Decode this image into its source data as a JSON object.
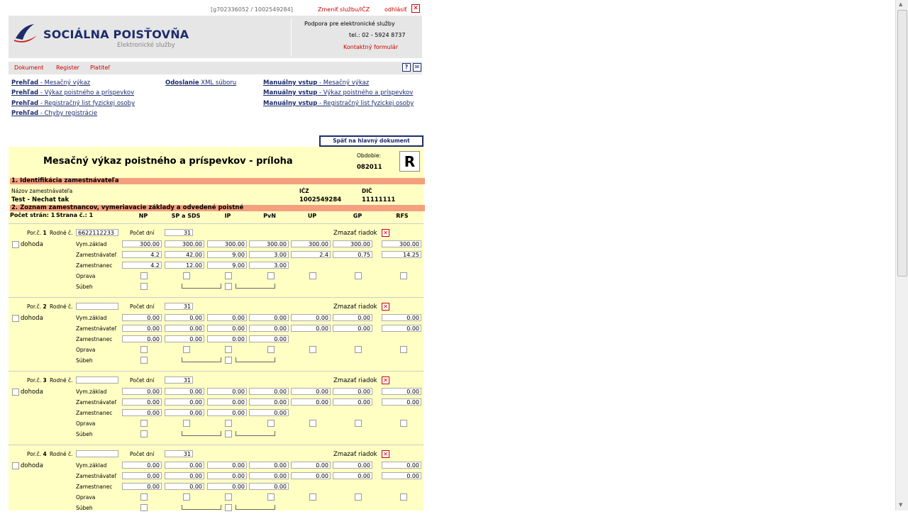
{
  "topbar": {
    "session": "[g702336052 / 1002549284]",
    "change_link": "Zmeniť službu/IČZ",
    "logout_link": "odhlásiť"
  },
  "header": {
    "logo_title": "SOCIÁLNA POISŤOVŇA",
    "logo_subtitle": "Elektronické služby",
    "support": "Podpora pre elektronické služby",
    "phone": "tel.: 02 - 5924 8737",
    "contact": "Kontaktný formulár"
  },
  "nav": {
    "items": [
      "Dokument",
      "Register",
      "Platiteľ"
    ]
  },
  "links": {
    "col1": [
      {
        "bold": "Prehľad",
        "rest": " - Mesačný výkaz"
      },
      {
        "bold": "Prehľad",
        "rest": " - Výkaz poistného a príspevkov"
      },
      {
        "bold": "Prehľad",
        "rest": " - Registračný list fyzickej osoby"
      },
      {
        "bold": "Prehľad",
        "rest": " - Chyby registrácie"
      }
    ],
    "col2": [
      {
        "bold": "Odoslanie",
        "rest": " XML súboru"
      }
    ],
    "col3": [
      {
        "bold": "Manuálny vstup",
        "rest": " - Mesačný výkaz"
      },
      {
        "bold": "Manuálny vstup",
        "rest": " - Výkaz poistného a príspevkov"
      },
      {
        "bold": "Manuálny vstup",
        "rest": " - Registračný list fyzickej osoby"
      }
    ]
  },
  "back_button": "Späť na hlavný dokument",
  "form": {
    "title": "Mesačný výkaz poistného a príspevkov - príloha",
    "period_label": "Obdobie:",
    "period_value": "082011",
    "letter": "R",
    "section1": "1. Identifikácia zamestnávateľa",
    "employer_name_label": "Názov zamestnávateľa",
    "employer_name": "Test - Nechat tak",
    "icz_label": "IČZ",
    "icz": "1002549284",
    "dic_label": "DIČ",
    "dic": "11111111",
    "section2": "2. Zoznam zamestnancov, vymeriavacie základy a odvedené poistné",
    "pages_label": "Počet strán:",
    "pages": "1",
    "page_label": "Strana č.:",
    "page": "1",
    "columns": [
      "NP",
      "SP a SDS",
      "IP",
      "PvN",
      "UP",
      "GP",
      "RFS"
    ],
    "labels": {
      "porc": "Por.č.",
      "rodne": "Rodné č.",
      "days": "Počet dní",
      "delete": "Zmazať riadok",
      "dohoda": "dohoda",
      "vym": "Vym.základ",
      "zamestnavatel": "Zamestnávateľ",
      "zamestnanec": "Zamestnanec",
      "oprava": "Oprava",
      "subeh": "Súbeh"
    },
    "employees": [
      {
        "num": "1",
        "rodne": "6622112233",
        "days": "31",
        "vym": [
          "300.00",
          "300.00",
          "300.00",
          "300.00",
          "300.00",
          "300.00",
          "300.00"
        ],
        "zamestnavatel": [
          "4.2",
          "42.00",
          "9.00",
          "3.00",
          "2.4",
          "0.75",
          "14.25"
        ],
        "zamestnanec": [
          "4.2",
          "12.00",
          "9.00",
          "3.00"
        ]
      },
      {
        "num": "2",
        "rodne": "",
        "days": "31",
        "vym": [
          "0.00",
          "0.00",
          "0.00",
          "0.00",
          "0.00",
          "0.00",
          "0.00"
        ],
        "zamestnavatel": [
          "0.00",
          "0.00",
          "0.00",
          "0.00",
          "0.00",
          "0.00",
          "0.00"
        ],
        "zamestnanec": [
          "0.00",
          "0.00",
          "0.00",
          "0.00"
        ]
      },
      {
        "num": "3",
        "rodne": "",
        "days": "31",
        "vym": [
          "0.00",
          "0.00",
          "0.00",
          "0.00",
          "0.00",
          "0.00",
          "0.00"
        ],
        "zamestnavatel": [
          "0.00",
          "0.00",
          "0.00",
          "0.00",
          "0.00",
          "0.00",
          "0.00"
        ],
        "zamestnanec": [
          "0.00",
          "0.00",
          "0.00",
          "0.00"
        ]
      },
      {
        "num": "4",
        "rodne": "",
        "days": "31",
        "vym": [
          "0.00",
          "0.00",
          "0.00",
          "0.00",
          "0.00",
          "0.00",
          "0.00"
        ],
        "zamestnavatel": [
          "0.00",
          "0.00",
          "0.00",
          "0.00",
          "0.00",
          "0.00",
          "0.00"
        ],
        "zamestnanec": [
          "0.00",
          "0.00",
          "0.00",
          "0.00"
        ]
      }
    ]
  },
  "colors": {
    "brand": "#1d2c6c",
    "link": "#cc0000",
    "form_bg": "#ffffc4",
    "section_bg": "#f4a07e"
  }
}
